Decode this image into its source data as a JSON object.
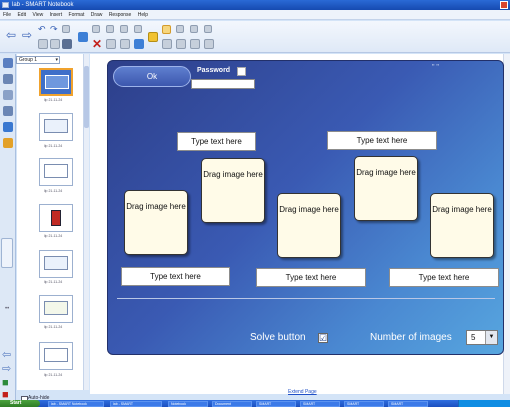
{
  "window": {
    "title": "lab - SMART Notebook"
  },
  "menu": [
    "File",
    "Edit",
    "View",
    "Insert",
    "Format",
    "Draw",
    "Response",
    "Help"
  ],
  "sorter": {
    "group": "Group 1",
    "thumbnails": [
      {
        "label": "lip 21-11-24",
        "active": true
      },
      {
        "label": "lip 21-11-24",
        "active": false
      },
      {
        "label": "lip 21-11-24",
        "active": false
      },
      {
        "label": "lip 21-11-24",
        "active": false
      },
      {
        "label": "lip 21-11-24",
        "active": false
      },
      {
        "label": "lip 21-11-24",
        "active": false
      },
      {
        "label": "lip 21-11-24",
        "active": false
      }
    ],
    "autohide_label": "Auto-hide"
  },
  "board": {
    "ok_label": "Ok",
    "password_label": "Password",
    "tick_mark": "\" \"",
    "text_placeholder": "Type text here",
    "image_placeholder": "Drag image here",
    "top_text_boxes": [
      "Type text here",
      "Type text here"
    ],
    "image_boxes": [
      "Drag image here",
      "Drag image here",
      "Drag image here",
      "Drag image here",
      "Drag image here"
    ],
    "bottom_text_boxes": [
      "Type text here",
      "Type text here",
      "Type text here"
    ],
    "solve_label": "Solve button",
    "solve_checked": true,
    "solve_check_glyph": "☑",
    "num_images_label": "Number of images",
    "num_images_value": "5"
  },
  "extend_page_label": "Extend Page",
  "taskbar": {
    "start_label": "Start",
    "tasks": [
      "lab - SMART Notebook",
      "lab - SMART",
      "Notebook",
      "Document",
      "SMART",
      "SMART",
      "SMART",
      "SMART"
    ]
  },
  "colors": {
    "board_dark": "#2d3f8a",
    "board_light": "#57a6df",
    "image_box_fill": "#fffbe8"
  }
}
